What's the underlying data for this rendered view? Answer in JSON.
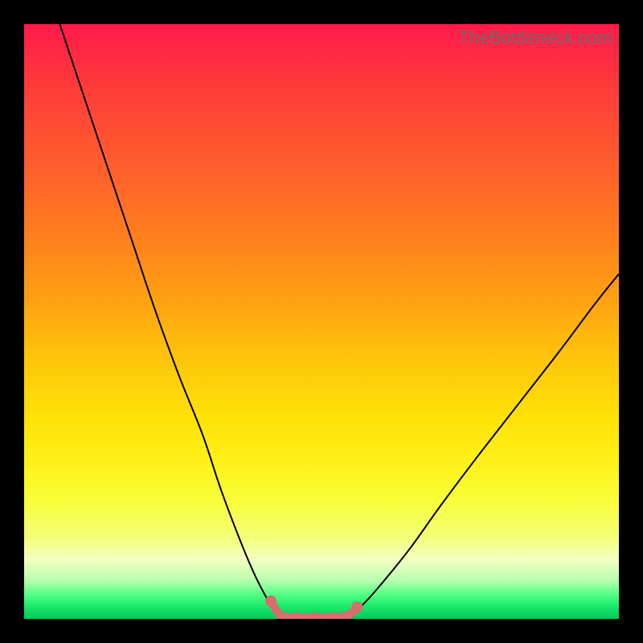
{
  "watermark": "TheBottleneck.com",
  "marker_color": "#d96d6d",
  "chart_data": {
    "type": "line",
    "title": "",
    "xlabel": "",
    "ylabel": "",
    "xlim": [
      0,
      100
    ],
    "ylim": [
      0,
      100
    ],
    "series": [
      {
        "name": "left-curve",
        "x": [
          6,
          10,
          14,
          18,
          22,
          26,
          30,
          33,
          36,
          38.5,
          40.5,
          42,
          43.2
        ],
        "y": [
          100,
          88,
          76,
          64,
          52,
          41,
          31,
          22,
          14,
          8,
          4,
          1.5,
          0.5
        ]
      },
      {
        "name": "right-curve",
        "x": [
          54.5,
          56,
          58,
          61,
          65,
          70,
          76,
          83,
          90,
          96,
          100
        ],
        "y": [
          0.5,
          1.5,
          3.5,
          7,
          12,
          19,
          27,
          36,
          45,
          53,
          58
        ]
      },
      {
        "name": "flat-bottom",
        "x": [
          43.2,
          46,
          49,
          52,
          54.5
        ],
        "y": [
          0.5,
          0.2,
          0.2,
          0.2,
          0.5
        ]
      }
    ],
    "markers": {
      "name": "highlight-band",
      "x": [
        41.5,
        43.2,
        46,
        49,
        52,
        54.5,
        56
      ],
      "y": [
        3.0,
        0.6,
        0.3,
        0.3,
        0.3,
        0.6,
        2.0
      ]
    }
  }
}
